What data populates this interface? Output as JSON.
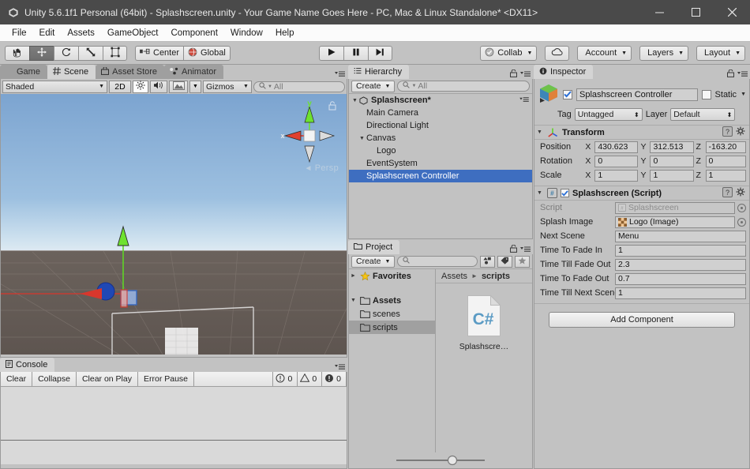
{
  "window": {
    "title": "Unity 5.6.1f1 Personal (64bit) - Splashscreen.unity - Your Game Name Goes Here - PC, Mac & Linux Standalone* <DX11>",
    "logo_icon": "unity-logo-icon",
    "minimize_label": "minimize-icon",
    "maximize_label": "maximize-icon",
    "close_label": "close-icon"
  },
  "menubar": {
    "items": [
      {
        "label": "File"
      },
      {
        "label": "Edit"
      },
      {
        "label": "Assets"
      },
      {
        "label": "GameObject"
      },
      {
        "label": "Component"
      },
      {
        "label": "Window"
      },
      {
        "label": "Help"
      }
    ]
  },
  "toolbar": {
    "transform_tools": [
      {
        "name": "hand-tool",
        "icon": "hand-icon",
        "active": false
      },
      {
        "name": "move-tool",
        "icon": "move-arrows-icon",
        "active": true
      },
      {
        "name": "rotate-tool",
        "icon": "rotate-icon",
        "active": false
      },
      {
        "name": "scale-tool",
        "icon": "scale-icon",
        "active": false
      },
      {
        "name": "rect-tool",
        "icon": "rect-transform-icon",
        "active": false
      }
    ],
    "pivot_label": "Center",
    "pivot_icon": "pivot-center-icon",
    "space_label": "Global",
    "space_icon": "globe-icon",
    "play_icon": "play-icon",
    "pause_icon": "pause-icon",
    "step_icon": "step-icon",
    "collab_label": "Collab",
    "collab_icon": "collab-check-icon",
    "cloud_icon": "cloud-icon",
    "account_label": "Account",
    "layers_label": "Layers",
    "layout_label": "Layout"
  },
  "scene": {
    "tabs": [
      {
        "label": "Game",
        "icon": "game-view-icon",
        "active": false
      },
      {
        "label": "Scene",
        "icon": "scene-grid-icon",
        "active": true
      },
      {
        "label": "Asset Store",
        "icon": "asset-store-icon",
        "active": false
      },
      {
        "label": "Animator",
        "icon": "animator-icon",
        "active": false
      }
    ],
    "shading_mode": "Shaded",
    "view_2d_label": "2D",
    "lighting_icon": "sun-icon",
    "audio_icon": "speaker-icon",
    "effects_icon": "image-effects-icon",
    "gizmos_label": "Gizmos",
    "search_placeholder": "All",
    "gizmo_axis_x": "x",
    "gizmo_axis_y": "y",
    "projection_label": "Persp",
    "lock_icon": "lock-open-icon"
  },
  "console": {
    "tab_label": "Console",
    "tab_icon": "console-icon",
    "buttons": [
      {
        "label": "Clear"
      },
      {
        "label": "Collapse"
      },
      {
        "label": "Clear on Play"
      },
      {
        "label": "Error Pause"
      }
    ],
    "counts": [
      {
        "icon": "info-icon",
        "value": "0"
      },
      {
        "icon": "warning-icon",
        "value": "0"
      },
      {
        "icon": "error-icon",
        "value": "0"
      }
    ]
  },
  "hierarchy": {
    "tab_label": "Hierarchy",
    "tab_icon": "hierarchy-icon",
    "create_label": "Create",
    "search_placeholder": "All",
    "scene_name": "Splashscreen*",
    "scene_icon": "unity-scene-icon",
    "items": [
      {
        "label": "Main Camera",
        "depth": 1,
        "expandable": false,
        "selected": false
      },
      {
        "label": "Directional Light",
        "depth": 1,
        "expandable": false,
        "selected": false
      },
      {
        "label": "Canvas",
        "depth": 1,
        "expandable": true,
        "selected": false
      },
      {
        "label": "Logo",
        "depth": 2,
        "expandable": false,
        "selected": false
      },
      {
        "label": "EventSystem",
        "depth": 1,
        "expandable": false,
        "selected": false
      },
      {
        "label": "Splashscreen Controller",
        "depth": 1,
        "expandable": false,
        "selected": true
      }
    ]
  },
  "project": {
    "tab_label": "Project",
    "tab_icon": "folder-icon",
    "create_label": "Create",
    "search_placeholder": "",
    "filter_type_icon": "filter-by-type-icon",
    "filter_label_icon": "filter-by-label-icon",
    "favorite_icon": "star-icon",
    "tree": [
      {
        "label": "Favorites",
        "depth": 0,
        "icon": "star-icon",
        "expanded": false,
        "bold": true,
        "selected": false
      },
      {
        "label": "Assets",
        "depth": 0,
        "icon": "folder-icon",
        "expanded": true,
        "bold": true,
        "selected": false
      },
      {
        "label": "scenes",
        "depth": 1,
        "icon": "folder-icon",
        "expanded": null,
        "bold": false,
        "selected": false
      },
      {
        "label": "scripts",
        "depth": 1,
        "icon": "folder-icon",
        "expanded": null,
        "bold": false,
        "selected": true
      }
    ],
    "breadcrumb": [
      {
        "label": "Assets",
        "current": false
      },
      {
        "label": "scripts",
        "current": true
      }
    ],
    "assets": [
      {
        "label": "Splashscre…",
        "icon": "csharp-script-icon"
      }
    ],
    "zoom_slider_value": 62
  },
  "inspector": {
    "tab_label": "Inspector",
    "tab_icon": "inspector-info-icon",
    "object_icon": "gameobject-cube-icon",
    "object_enabled": true,
    "object_name": "Splashscreen Controller",
    "static_label": "Static",
    "static_checked": false,
    "tag_label": "Tag",
    "tag_value": "Untagged",
    "layer_label": "Layer",
    "layer_value": "Default",
    "help_icon": "help-book-icon",
    "settings_icon": "gear-icon",
    "components": [
      {
        "title": "Transform",
        "icon": "transform-axis-icon",
        "has_enable_checkbox": false,
        "rows": [
          {
            "label": "Position",
            "fields": [
              {
                "axis": "X",
                "value": "430.623"
              },
              {
                "axis": "Y",
                "value": "312.513"
              },
              {
                "axis": "Z",
                "value": "-163.20"
              }
            ]
          },
          {
            "label": "Rotation",
            "fields": [
              {
                "axis": "X",
                "value": "0"
              },
              {
                "axis": "Y",
                "value": "0"
              },
              {
                "axis": "Z",
                "value": "0"
              }
            ]
          },
          {
            "label": "Scale",
            "fields": [
              {
                "axis": "X",
                "value": "1"
              },
              {
                "axis": "Y",
                "value": "1"
              },
              {
                "axis": "Z",
                "value": "1"
              }
            ]
          }
        ]
      }
    ],
    "script_component": {
      "title": "Splashscreen (Script)",
      "icon": "csharp-script-icon",
      "enabled": true,
      "properties": [
        {
          "label": "Script",
          "value": "Splashscreen",
          "kind": "object",
          "icon": "csharp-script-icon",
          "disabled": true
        },
        {
          "label": "Splash Image",
          "value": "Logo (Image)",
          "kind": "object",
          "icon": "image-asset-icon",
          "disabled": false
        },
        {
          "label": "Next Scene",
          "value": "Menu",
          "kind": "text",
          "disabled": false
        },
        {
          "label": "Time To Fade In",
          "value": "1",
          "kind": "text",
          "disabled": false
        },
        {
          "label": "Time Till Fade Out",
          "value": "2.3",
          "kind": "text",
          "disabled": false
        },
        {
          "label": "Time To Fade Out",
          "value": "0.7",
          "kind": "text",
          "disabled": false
        },
        {
          "label": "Time Till Next Scene",
          "value": "1",
          "kind": "text",
          "disabled": false
        }
      ]
    },
    "add_component_label": "Add Component"
  },
  "colors": {
    "chrome": "#c2c2c2",
    "titlebar": "#4a4a4a",
    "selection_blue": "#3e6ec0",
    "panel_light": "#d4d4d4",
    "axis_x": "#d8372c",
    "axis_y": "#5fd425",
    "axis_z": "#2c5ad8"
  }
}
